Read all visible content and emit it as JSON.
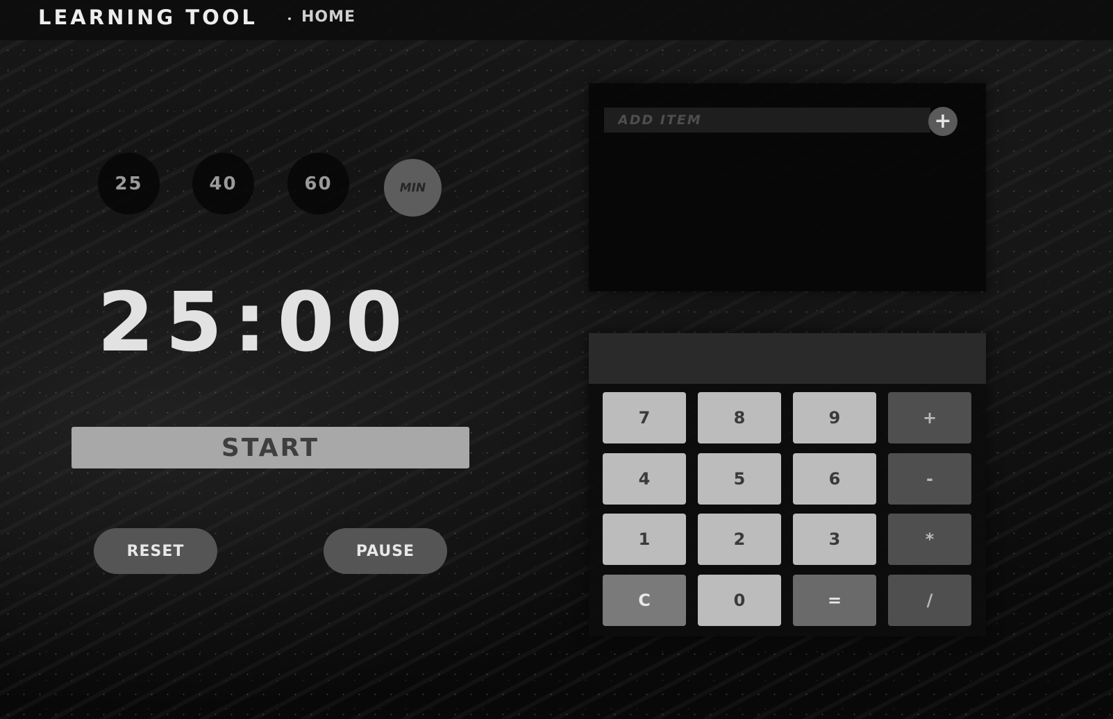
{
  "header": {
    "brand": "LEARNING TOOL",
    "nav_home": "HOME"
  },
  "timer": {
    "presets": [
      "25",
      "40",
      "60"
    ],
    "unit_label": "MIN",
    "display": "25:00",
    "start_label": "START",
    "reset_label": "RESET",
    "pause_label": "PAUSE"
  },
  "todo": {
    "placeholder": "ADD ITEM",
    "add_icon": "plus-icon",
    "add_glyph": "+"
  },
  "calculator": {
    "display_value": "",
    "keys": [
      [
        "7",
        "8",
        "9",
        "+"
      ],
      [
        "4",
        "5",
        "6",
        "-"
      ],
      [
        "1",
        "2",
        "3",
        "*"
      ],
      [
        "C",
        "0",
        "=",
        "/"
      ]
    ]
  }
}
